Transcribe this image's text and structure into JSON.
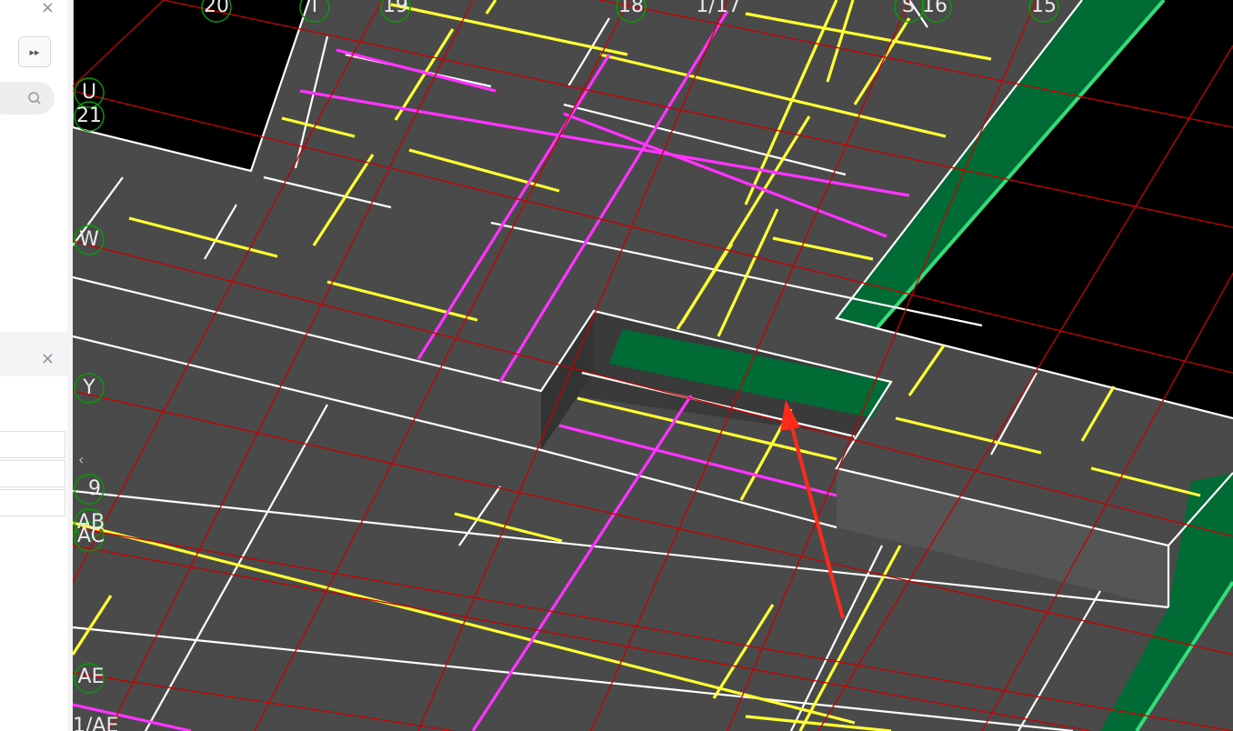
{
  "left_panel": {
    "top_close": "×",
    "expand_button": "▸▸",
    "search_icon": "search-icon",
    "bottom_close": "×",
    "collapse_arrow": "‹"
  },
  "viewport": {
    "axis_labels": [
      "20",
      "T",
      "19",
      "18",
      "1/17",
      "S",
      "16",
      "15",
      "U",
      "21",
      "W",
      "Y",
      "9",
      "AB",
      "AC",
      "AE",
      "1/AE"
    ],
    "colors": {
      "background": "#000000",
      "slab": "#4a4a4a",
      "grid_line": "#c80000",
      "yellow_member": "#ffff33",
      "magenta_member": "#ff33ff",
      "white_edge": "#ffffff",
      "green_slab": "#006b35",
      "green_edge": "#33dd77",
      "annotation_arrow": "#ff2a1a"
    }
  }
}
